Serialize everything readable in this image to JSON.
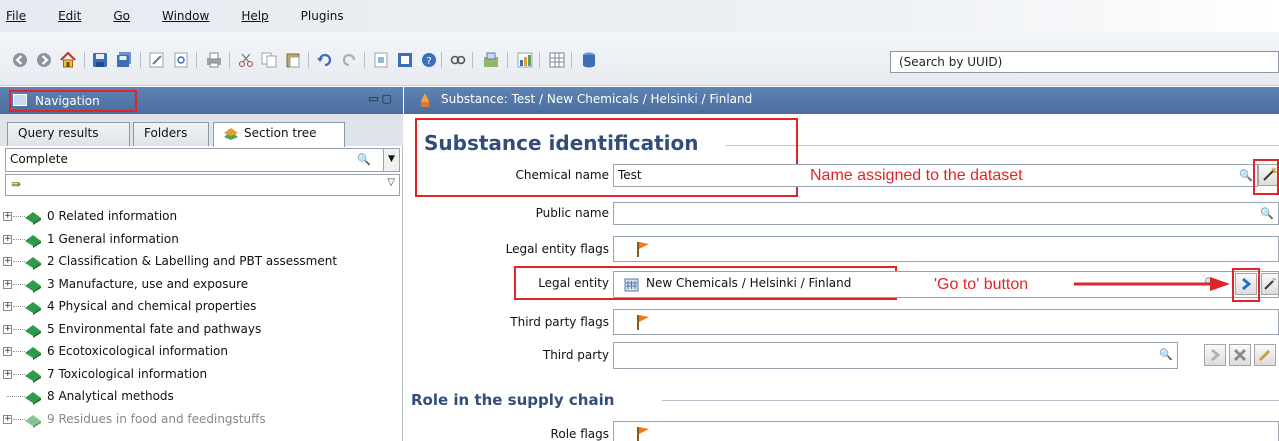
{
  "menu": [
    "File",
    "Edit",
    "Go",
    "Window",
    "Help",
    "Plugins"
  ],
  "toolbar": {
    "search_placeholder": "(Search by UUID)"
  },
  "navigation": {
    "title": "Navigation",
    "tabs": [
      "Query results",
      "Folders",
      "Section tree"
    ],
    "filter_value": "Complete",
    "tree": [
      "0 Related information",
      "1 General information",
      "2 Classification & Labelling and PBT assessment",
      "3 Manufacture, use and exposure",
      "4 Physical and chemical properties",
      "5 Environmental fate and pathways",
      "6 Ecotoxicological information",
      "7 Toxicological information",
      "8 Analytical methods",
      "9 Residues in food and feedingstuffs"
    ]
  },
  "editor": {
    "header": "Substance: Test  / New Chemicals / Helsinki / Finland",
    "section1": "Substance identification",
    "chemical_name_label": "Chemical name",
    "chemical_name_value": "Test",
    "public_name_label": "Public name",
    "legal_entity_flags_label": "Legal entity flags",
    "legal_entity_label": "Legal entity",
    "legal_entity_value": "New Chemicals / Helsinki / Finland",
    "third_party_flags_label": "Third party flags",
    "third_party_label": "Third party",
    "section2": "Role in the supply chain",
    "role_flags_label": "Role flags"
  },
  "annotations": {
    "name_note": "Name assigned to the dataset",
    "goto_note": "'Go to' button"
  },
  "colors": {
    "annotation_red": "#e0242a",
    "header_blue": "#4f74a6"
  }
}
